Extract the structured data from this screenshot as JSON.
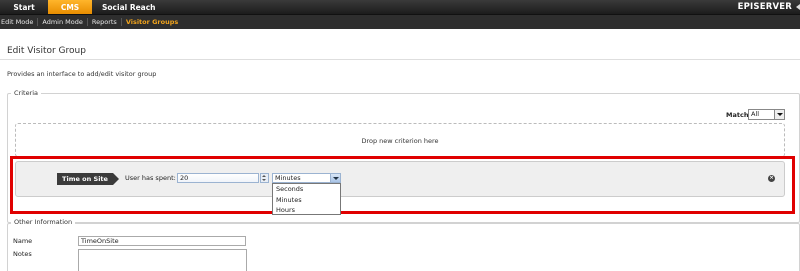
{
  "top_nav": {
    "tabs": [
      {
        "label": "Start"
      },
      {
        "label": "CMS"
      },
      {
        "label": "Social Reach"
      }
    ],
    "brand": "EPISERVER"
  },
  "sub_nav": {
    "items": [
      {
        "label": "Edit Mode"
      },
      {
        "label": "Admin Mode"
      },
      {
        "label": "Reports"
      },
      {
        "label": "Visitor Groups"
      }
    ]
  },
  "page": {
    "title": "Edit Visitor Group",
    "description": "Provides an interface to add/edit visitor group"
  },
  "criteria": {
    "legend": "Criteria",
    "match_label": "Match",
    "match_value": "All",
    "drop_zone_text": "Drop new criterion here",
    "criterion": {
      "name": "Time on Site",
      "spent_label": "User has spent:",
      "spent_value": "20",
      "unit_value": "Minutes",
      "unit_options": [
        "Seconds",
        "Minutes",
        "Hours"
      ]
    }
  },
  "other": {
    "legend": "Other Information",
    "name_label": "Name",
    "name_value": "TimeOnSite",
    "notes_label": "Notes"
  },
  "colors": {
    "active_tab": "#f29a0e",
    "highlight": "#e00000",
    "active_subnav": "#f2a41c"
  },
  "icons": {
    "remove": "remove-circle-icon",
    "spinner": "spinner-arrows-icon",
    "dropdown": "chevron-down-icon"
  }
}
